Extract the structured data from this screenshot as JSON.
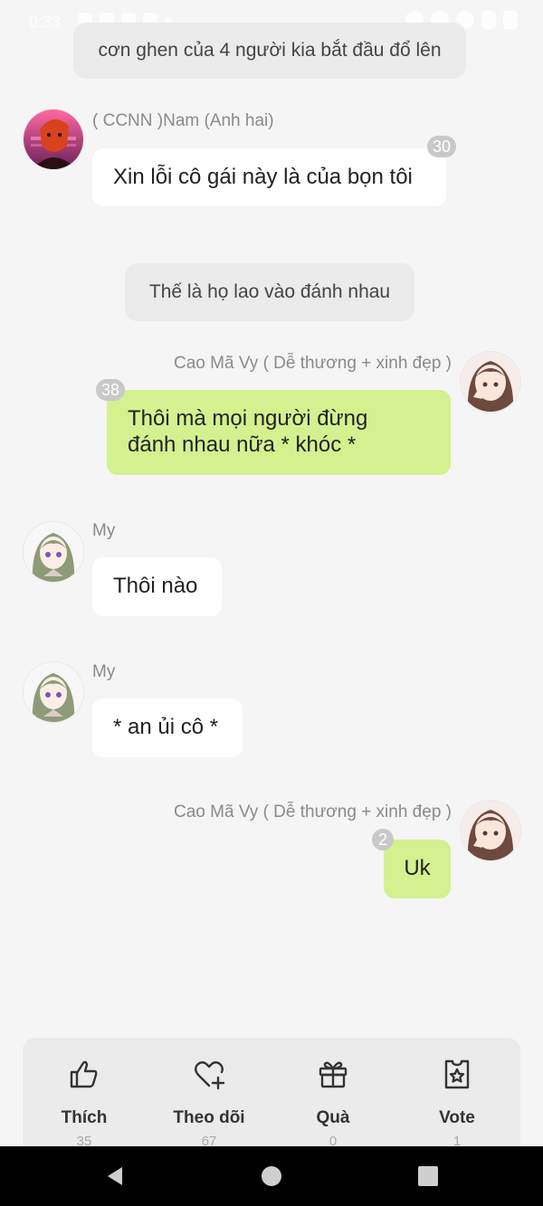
{
  "status_bar": {
    "time": "0:33",
    "icons": [
      "notification-icon",
      "notification-icon",
      "notification-icon",
      "notification-icon",
      "dot-icon",
      "mute-icon",
      "dnd-icon",
      "wifi-icon",
      "signal-icon",
      "battery-icon"
    ]
  },
  "messages": [
    {
      "type": "narration",
      "text": "cơn ghen của 4 người kia bắt đầu đổ lên"
    },
    {
      "type": "incoming",
      "sender": "( CCNN )Nam (Anh hai)",
      "text": "Xin  lỗi cô gái này là của bọn tôi",
      "count": "30"
    },
    {
      "type": "narration",
      "text": "Thế là họ lao vào đánh nhau"
    },
    {
      "type": "outgoing",
      "sender": "Cao Mã Vy ( Dễ thương + xinh đẹp )",
      "line1": "Thôi mà mọi người đừng",
      "line2": "đánh nhau nữa * khóc *",
      "count": "38"
    },
    {
      "type": "incoming",
      "sender": "My",
      "text": "Thôi nào"
    },
    {
      "type": "incoming",
      "sender": "My",
      "text": "* an ủi cô *"
    },
    {
      "type": "outgoing",
      "sender": "Cao Mã Vy ( Dễ thương + xinh đẹp )",
      "text": "Uk",
      "count": "2"
    }
  ],
  "actions": [
    {
      "label": "Thích",
      "count": "35",
      "icon": "thumbs-up-icon"
    },
    {
      "label": "Theo dõi",
      "count": "67",
      "icon": "heart-plus-icon"
    },
    {
      "label": "Quà",
      "count": "0",
      "icon": "gift-icon"
    },
    {
      "label": "Vote",
      "count": "1",
      "icon": "vote-star-icon"
    }
  ],
  "colors": {
    "background": "#f5f5f5",
    "incoming_bubble": "#ffffff",
    "outgoing_bubble": "#d4f190",
    "narration_bubble": "#ebebeb",
    "badge": "#c9c9c9"
  }
}
